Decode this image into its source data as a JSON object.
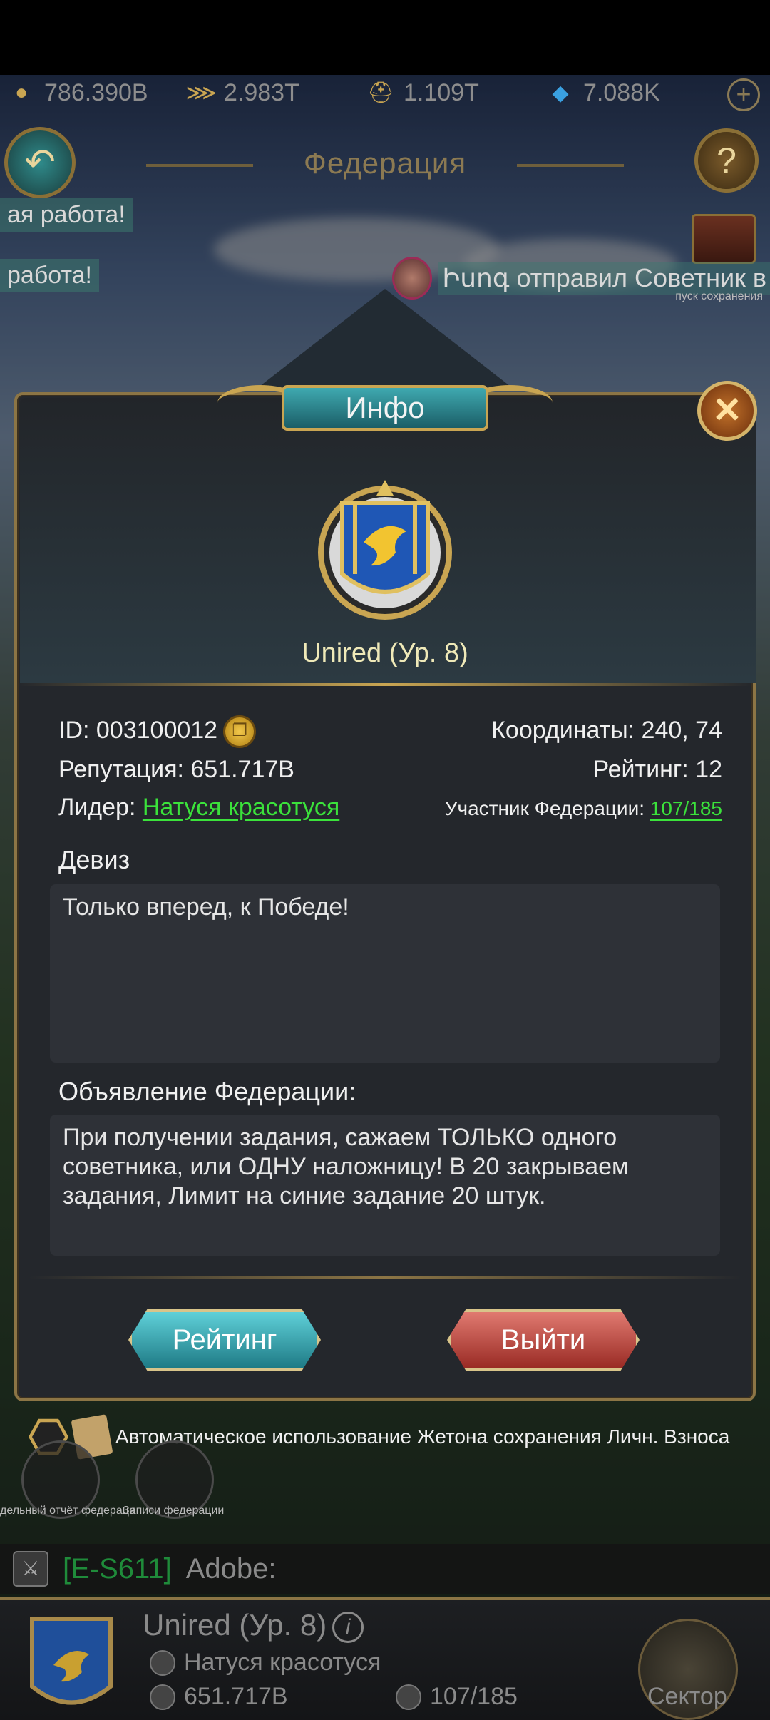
{
  "resources": [
    {
      "icon": "gold-coin-icon",
      "value": "786.390B"
    },
    {
      "icon": "grain-icon",
      "value": "2.983T"
    },
    {
      "icon": "soldier-helmet-icon",
      "value": "1.109T"
    },
    {
      "icon": "diamond-icon",
      "value": "7.088K"
    }
  ],
  "header": {
    "title": "Федерация"
  },
  "tickers": [
    "ая работа!",
    "работа!"
  ],
  "chat_popup": {
    "text": "Իսոգ отправил Советник в З",
    "sub": "пуск сохранения"
  },
  "dialog": {
    "tab_title": "Инфо",
    "federation_name": "Unired (Ур. 8)",
    "id_label": "ID: 003100012",
    "coordinates_label": "Координаты: 240, 74",
    "reputation_label": "Репутация: 651.717B",
    "rating_label": "Рейтинг: 12",
    "leader_label": "Лидер:",
    "leader_name": "Натуся красотуся",
    "members_label": "Участник Федерации:",
    "members_value": "107/185",
    "motto_title": "Девиз",
    "motto_text": "Только вперед, к Победе!",
    "announcement_title": "Объявление Федерации:",
    "announcement_text": "При получении задания, сажаем ТОЛЬКО одного советника, или ОДНУ наложницу! В 20 закрываем задания, Лимит на синие задание 20 штук.",
    "rating_button": "Рейтинг",
    "exit_button": "Выйти"
  },
  "auto_use_text": "Автоматическое использование Жетона сохранения Личн. Взноса",
  "shortcuts": [
    "дельный отчёт федераци",
    "Записи федерации"
  ],
  "chat": {
    "tag": "[E-S611]",
    "message": "Adobe:"
  },
  "bottom": {
    "name": "Unired (Ур. 8)",
    "leader": "Натуся красотуся",
    "reputation": "651.717B",
    "members": "107/185",
    "sector": "Сектор"
  },
  "colors": {
    "accent_gold": "#c9a552",
    "green": "#3be23b",
    "panel": "#24272c"
  }
}
